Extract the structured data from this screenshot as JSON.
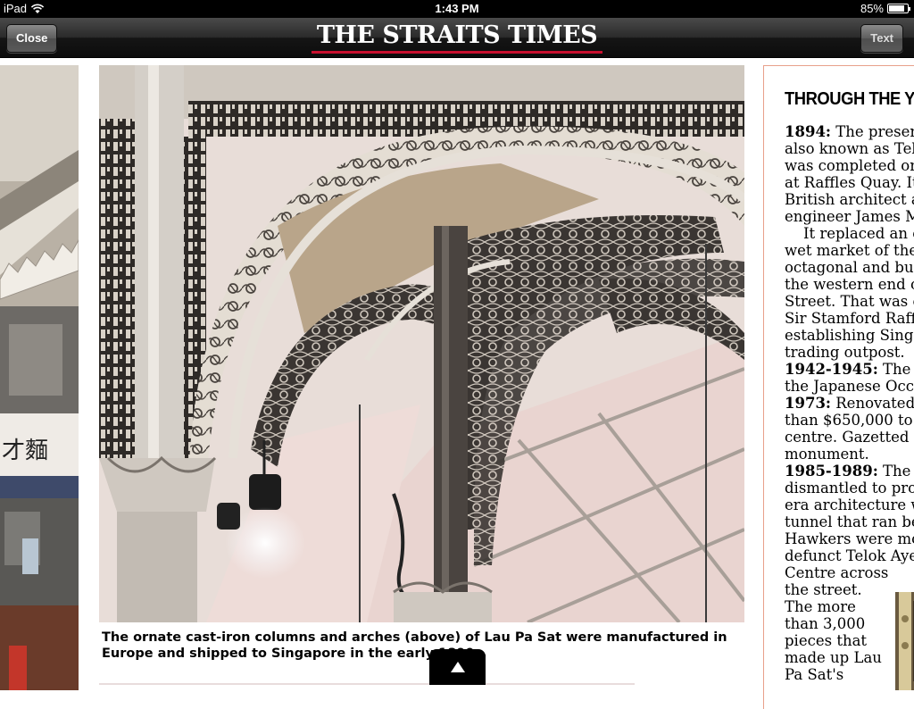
{
  "status_bar": {
    "device": "iPad",
    "time": "1:43 PM",
    "battery": "85%",
    "battery_level": 0.85
  },
  "nav": {
    "close_label": "Close",
    "masthead": "THE STRAITS TIMES",
    "text_label": "Text",
    "accent_color": "#c8102e"
  },
  "caption": "The ornate cast-iron columns and arches (above) of Lau Pa Sat were manufactured in Europe and shipped to Singapore in the early 1890s.",
  "left_photo": {
    "sign_text": "才麵"
  },
  "article": {
    "title": "THROUGH THE Y",
    "lines": [
      {
        "b": "1894:",
        "t": " The present"
      },
      {
        "b": "",
        "t": "also known as Tel"
      },
      {
        "b": "",
        "t": "was completed on"
      },
      {
        "b": "",
        "t": "at Raffles Quay. It"
      },
      {
        "b": "",
        "t": "British architect ar"
      },
      {
        "b": "",
        "t": "engineer James Ma"
      },
      {
        "b": "",
        "t": "    It replaced an e"
      },
      {
        "b": "",
        "t": "wet market of the"
      },
      {
        "b": "",
        "t": "octagonal and bui"
      },
      {
        "b": "",
        "t": "the western end o"
      },
      {
        "b": "",
        "t": "Street. That was co"
      },
      {
        "b": "",
        "t": "Sir Stamford Raffle"
      },
      {
        "b": "",
        "t": "establishing Singa"
      },
      {
        "b": "",
        "t": "trading outpost."
      },
      {
        "b": "1942-1945:",
        "t": " The n"
      },
      {
        "b": "",
        "t": "the Japanese Occu"
      },
      {
        "b": "1973:",
        "t": " Renovated a"
      },
      {
        "b": "",
        "t": "than $650,000 to"
      },
      {
        "b": "",
        "t": "centre. Gazetted a"
      },
      {
        "b": "",
        "t": "monument."
      },
      {
        "b": "1985-1989:",
        "t": " The b"
      },
      {
        "b": "",
        "t": "dismantled to pro"
      },
      {
        "b": "",
        "t": "era architecture w"
      },
      {
        "b": "",
        "t": "tunnel that ran be"
      },
      {
        "b": "",
        "t": "Hawkers were mov"
      },
      {
        "b": "",
        "t": "defunct Telok Aye"
      },
      {
        "b": "",
        "t": "Centre across"
      },
      {
        "b": "",
        "t": "the street."
      },
      {
        "b": "",
        "t": "The more"
      },
      {
        "b": "",
        "t": "than 3,000"
      },
      {
        "b": "",
        "t": "pieces that"
      },
      {
        "b": "",
        "t": "made up Lau"
      },
      {
        "b": "",
        "t": "Pa Sat's"
      }
    ]
  }
}
